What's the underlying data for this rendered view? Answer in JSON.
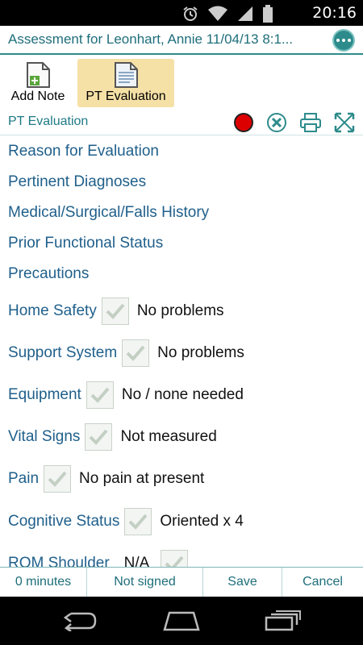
{
  "status_bar": {
    "time": "20:16"
  },
  "header": {
    "title": "Assessment for Leonhart, Annie  11/04/13  8:1..."
  },
  "toolbar": {
    "add_note_label": "Add Note",
    "pt_evaluation_label": "PT Evaluation"
  },
  "section": {
    "title": "PT Evaluation"
  },
  "sections": [
    "Reason for Evaluation",
    "Pertinent Diagnoses",
    "Medical/Surgical/Falls History",
    "Prior Functional Status",
    "Precautions"
  ],
  "checks": [
    {
      "label": "Home Safety",
      "value": "No problems",
      "checked": true
    },
    {
      "label": "Support System",
      "value": "No problems",
      "checked": true
    },
    {
      "label": "Equipment",
      "value": "No / none needed",
      "checked": true
    },
    {
      "label": "Vital Signs",
      "value": "Not measured",
      "checked": true
    },
    {
      "label": "Pain",
      "value": "No pain at present",
      "checked": true
    },
    {
      "label": "Cognitive Status",
      "value": "Oriented x 4",
      "checked": true
    },
    {
      "label": "ROM Shoulder",
      "value": "N/A",
      "checked": true
    }
  ],
  "footer": {
    "duration": "0 minutes",
    "signed_status": "Not signed",
    "save_label": "Save",
    "cancel_label": "Cancel"
  },
  "colors": {
    "accent": "#2e8b8b",
    "link": "#1f5f8b",
    "highlight": "#f5e0a6",
    "record": "#dd0000"
  }
}
